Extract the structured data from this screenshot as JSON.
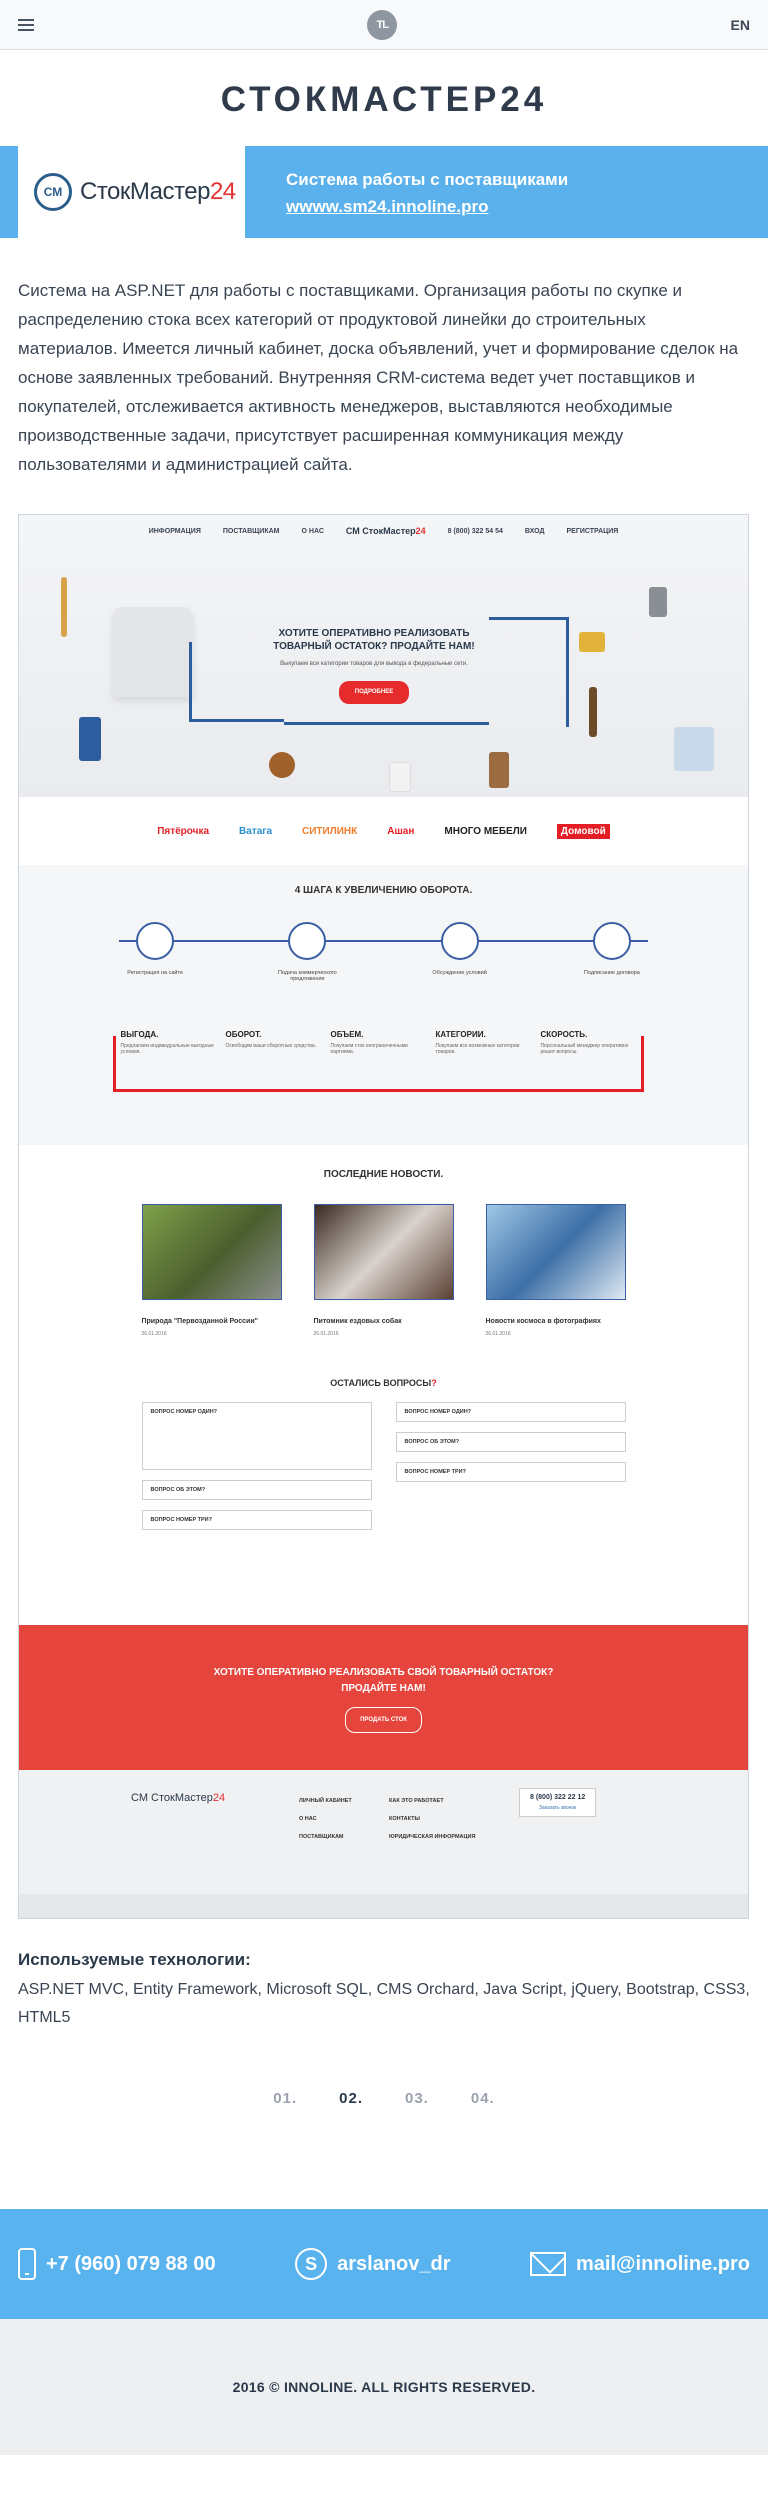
{
  "topbar": {
    "logo": "TL",
    "lang": "EN"
  },
  "title": "СТОКМАСТЕР24",
  "banner": {
    "brand_badge": "СМ",
    "brand_name": "СтокМастер",
    "brand_suffix": "24",
    "heading": "Система работы с поставщиками",
    "link": "wwww.sm24.innoline.pro"
  },
  "description": "Система на ASP.NET для работы с поставщиками. Организация работы по скупке и распределению стока всех категорий от продуктовой линейки до строительных материалов. Имеется личный кабинет, доска объявлений, учет и формирование сделок на основе заявленных требований. Внутренняя CRM-система ведет учет поставщиков и покупателей, отслеживается активность менеджеров, выставляются необходимые производственные задачи, присутствует расширенная коммуникация между пользователями и администрацией сайта.",
  "screenshot": {
    "nav": [
      "ИНФОРМАЦИЯ",
      "ПОСТАВЩИКАМ",
      "О НАС",
      "8 (800) 322 54 54",
      "ВХОД",
      "РЕГИСТРАЦИЯ"
    ],
    "hero_title": "ХОТИТЕ ОПЕРАТИВНО РЕАЛИЗОВАТЬ ТОВАРНЫЙ ОСТАТОК? ПРОДАЙТЕ НАМ!",
    "hero_sub": "Выкупаем все категории товаров для вывода в федеральные сети.",
    "hero_button": "ПОДРОБНЕЕ",
    "brands": [
      "Пятёрочка",
      "Ватага",
      "СИТИЛИНК",
      "Ашан",
      "МНОГО МЕБЕЛИ",
      "Домовой"
    ],
    "steps_title": "4 ШАГА К УВЕЛИЧЕНИЮ ОБОРОТА.",
    "steps": [
      "Регистрация на сайте",
      "Подача коммерческого предложения",
      "Обсуждение условий",
      "Подписание договора"
    ],
    "benefits": [
      {
        "title": "ВЫГОДА.",
        "text": "Предлагаем индивидуальные выгодные условия."
      },
      {
        "title": "ОБОРОТ.",
        "text": "Освободим ваши оборотные средства."
      },
      {
        "title": "ОБЪЕМ.",
        "text": "Покупаем сток неограниченными партиями."
      },
      {
        "title": "КАТЕГОРИИ.",
        "text": "Покупаем все возможные категории товаров."
      },
      {
        "title": "СКОРОСТЬ.",
        "text": "Персональный менеджер оперативно решит вопросы."
      }
    ],
    "news_title": "ПОСЛЕДНИЕ НОВОСТИ.",
    "news": [
      {
        "title": "Природа \"Первозданной России\"",
        "date": "26.01.2016"
      },
      {
        "title": "Питомник ездовых собак",
        "date": "26.01.2016"
      },
      {
        "title": "Новости космоса в фотографиях",
        "date": "26.01.2016"
      }
    ],
    "faq_title": "ОСТАЛИСЬ ВОПРОСЫ",
    "faq_mark": "?",
    "faq_left": [
      "ВОПРОС НОМЕР ОДИН?",
      "ВОПРОС ОБ ЭТОМ?",
      "ВОПРОС НОМЕР ТРИ?"
    ],
    "faq_right": [
      "ВОПРОС НОМЕР ОДИН?",
      "ВОПРОС ОБ ЭТОМ?",
      "ВОПРОС НОМЕР ТРИ?"
    ],
    "cta_text": "ХОТИТЕ ОПЕРАТИВНО РЕАЛИЗОВАТЬ СВОЙ ТОВАРНЫЙ ОСТАТОК? ПРОДАЙТЕ НАМ!",
    "cta_button": "ПРОДАТЬ СТОК",
    "footer_menu1": [
      "ЛИЧНЫЙ КАБИНЕТ",
      "О НАС",
      "ПОСТАВЩИКАМ"
    ],
    "footer_menu2": [
      "КАК ЭТО РАБОТАЕТ",
      "КОНТАКТЫ",
      "ЮРИДИЧЕСКАЯ ИНФОРМАЦИЯ"
    ],
    "footer_phone": "8 (800) 322 22 12",
    "footer_callback": "Заказать звонок"
  },
  "tech": {
    "heading": "Используемые технологии:",
    "list": "ASP.NET MVC, Entity Framework, Microsoft SQL, CMS Orchard, Java Script, jQuery, Bootstrap, CSS3, HTML5"
  },
  "pager": [
    "01.",
    "02.",
    "03.",
    "04."
  ],
  "contacts": {
    "phone": "+7 (960) 079 88 00",
    "skype": "arslanov_dr",
    "email": "mail@innoline.pro"
  },
  "footer": "2016 © INNOLINE. ALL RIGHTS RESERVED.",
  "colors": {
    "accent": "#59b3ee",
    "red": "#e31e24",
    "navy": "#2d5d9e"
  }
}
